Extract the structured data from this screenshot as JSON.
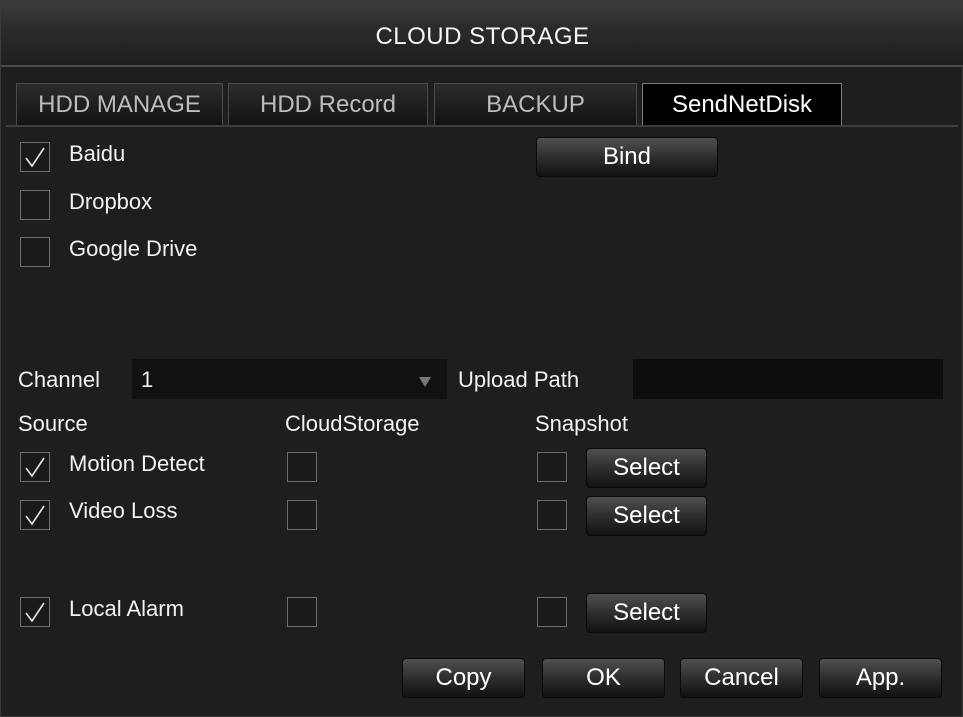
{
  "window": {
    "title": "CLOUD STORAGE"
  },
  "tabs": [
    {
      "label": "HDD MANAGE",
      "active": false
    },
    {
      "label": "HDD Record",
      "active": false
    },
    {
      "label": "BACKUP",
      "active": false
    },
    {
      "label": "SendNetDisk",
      "active": true
    }
  ],
  "services": [
    {
      "label": "Baidu",
      "checked": true
    },
    {
      "label": "Dropbox",
      "checked": false
    },
    {
      "label": "Google Drive",
      "checked": false
    }
  ],
  "bind_button": "Bind",
  "channel": {
    "label": "Channel",
    "value": "1"
  },
  "upload_path": {
    "label": "Upload Path",
    "value": ""
  },
  "columns": {
    "source": "Source",
    "cloud": "CloudStorage",
    "snapshot": "Snapshot"
  },
  "rows": [
    {
      "label": "Motion Detect",
      "source_checked": true,
      "cloud_checked": false,
      "snapshot_checked": false,
      "select_label": "Select"
    },
    {
      "label": "Video Loss",
      "source_checked": true,
      "cloud_checked": false,
      "snapshot_checked": false,
      "select_label": "Select"
    },
    {
      "label": "Local Alarm",
      "source_checked": true,
      "cloud_checked": false,
      "snapshot_checked": false,
      "select_label": "Select"
    }
  ],
  "footer": {
    "copy": "Copy",
    "ok": "OK",
    "cancel": "Cancel",
    "apply": "App."
  },
  "icons": {
    "check": "checkmark-icon",
    "dropdown": "dropdown-arrow-icon"
  },
  "colors": {
    "background": "#1e1e1e",
    "field": "#111111",
    "text": "#f2f2f2"
  }
}
